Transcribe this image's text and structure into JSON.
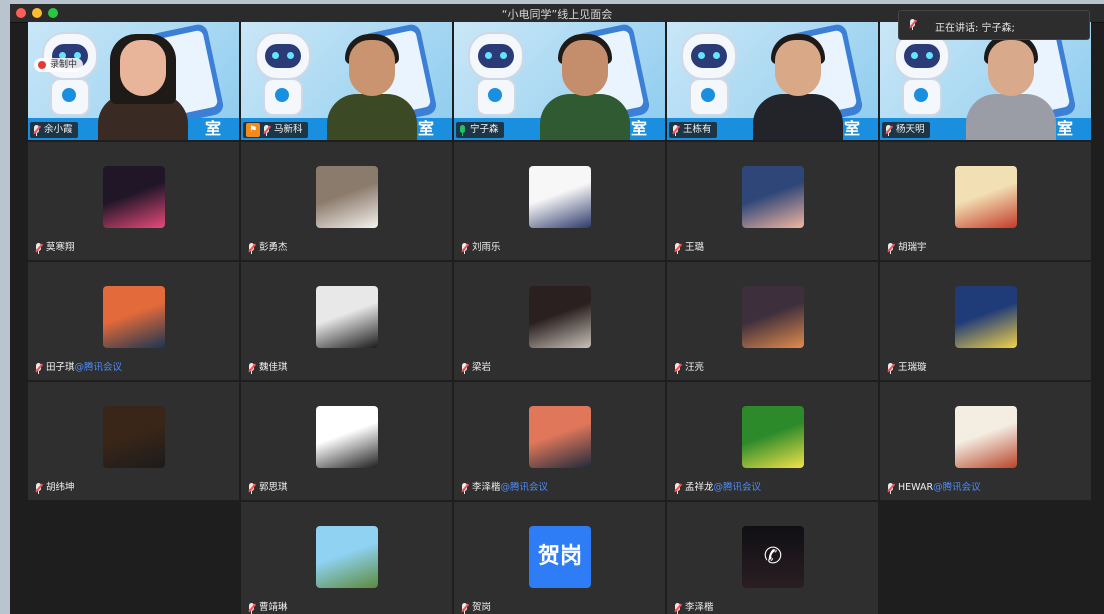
{
  "window": {
    "title": "“小电同学”线上见面会"
  },
  "speaker": {
    "label": "正在讲话: 宁子森;"
  },
  "recording": {
    "label": "录制中"
  },
  "camera_banner": "室",
  "suffix": "@腾讯会议",
  "camera_tiles": [
    {
      "name": "余小霞",
      "mic": "muted",
      "host": false,
      "active": false,
      "skin": "#e8b59a",
      "shirt": "#3a2a24"
    },
    {
      "name": "马新科",
      "mic": "muted",
      "host": true,
      "active": false,
      "skin": "#c9946f",
      "shirt": "#3b4a24"
    },
    {
      "name": "宁子森",
      "mic": "on",
      "host": false,
      "active": true,
      "skin": "#c48e6c",
      "shirt": "#2f5a32"
    },
    {
      "name": "王栋有",
      "mic": "muted",
      "host": false,
      "active": false,
      "skin": "#d9a886",
      "shirt": "#22242a"
    },
    {
      "name": "杨天明",
      "mic": "muted",
      "host": false,
      "active": false,
      "skin": "#d8a98a",
      "shirt": "#9a9da5"
    }
  ],
  "avatar_rows": [
    [
      {
        "name": "莫寒翔",
        "tag": false,
        "colors": [
          "#201628",
          "#e94a7b"
        ]
      },
      {
        "name": "彭勇杰",
        "tag": false,
        "colors": [
          "#8b7b6c",
          "#f5f2ee"
        ]
      },
      {
        "name": "刘雨乐",
        "tag": false,
        "colors": [
          "#f7f7f7",
          "#2d3a6b"
        ]
      },
      {
        "name": "王璐",
        "tag": false,
        "colors": [
          "#2f4778",
          "#f2b6a0"
        ]
      },
      {
        "name": "胡瑞宇",
        "tag": false,
        "colors": [
          "#f2e0b4",
          "#c23b2a"
        ]
      }
    ],
    [
      {
        "name": "田子琪",
        "tag": true,
        "colors": [
          "#e36a3a",
          "#1a3552"
        ]
      },
      {
        "name": "魏佳琪",
        "tag": false,
        "colors": [
          "#e8e8e8",
          "#1a1a1a"
        ]
      },
      {
        "name": "梁岩",
        "tag": false,
        "colors": [
          "#2a2020",
          "#c9c2b8"
        ]
      },
      {
        "name": "汪亮",
        "tag": false,
        "colors": [
          "#3d2f3c",
          "#e38c4e"
        ]
      },
      {
        "name": "王瑞璇",
        "tag": false,
        "colors": [
          "#1f3b78",
          "#f2d24a"
        ]
      }
    ],
    [
      {
        "name": "胡纬坤",
        "tag": false,
        "colors": [
          "#3a2618",
          "#1b1b1b"
        ]
      },
      {
        "name": "郭思琪",
        "tag": false,
        "colors": [
          "#ffffff",
          "#1f1f1f"
        ]
      },
      {
        "name": "李泽楷",
        "tag": true,
        "colors": [
          "#e0775a",
          "#202a3c"
        ]
      },
      {
        "name": "孟祥龙",
        "tag": true,
        "colors": [
          "#2c8a2a",
          "#f2e24a"
        ]
      },
      {
        "name": "HEWAR",
        "tag": true,
        "colors": [
          "#f3ede2",
          "#b8452a"
        ]
      }
    ],
    [
      {
        "name": "",
        "tag": false,
        "empty": true,
        "colors": []
      },
      {
        "name": "曹靖琳",
        "tag": false,
        "colors": [
          "#8fd2f2",
          "#5c8a3a"
        ]
      },
      {
        "name": "贺岗",
        "tag": false,
        "text": "贺岗",
        "colors": []
      },
      {
        "name": "李泽楷",
        "tag": false,
        "phone": true,
        "colors": []
      },
      {
        "name": "",
        "tag": false,
        "empty": true,
        "colors": []
      }
    ]
  ]
}
